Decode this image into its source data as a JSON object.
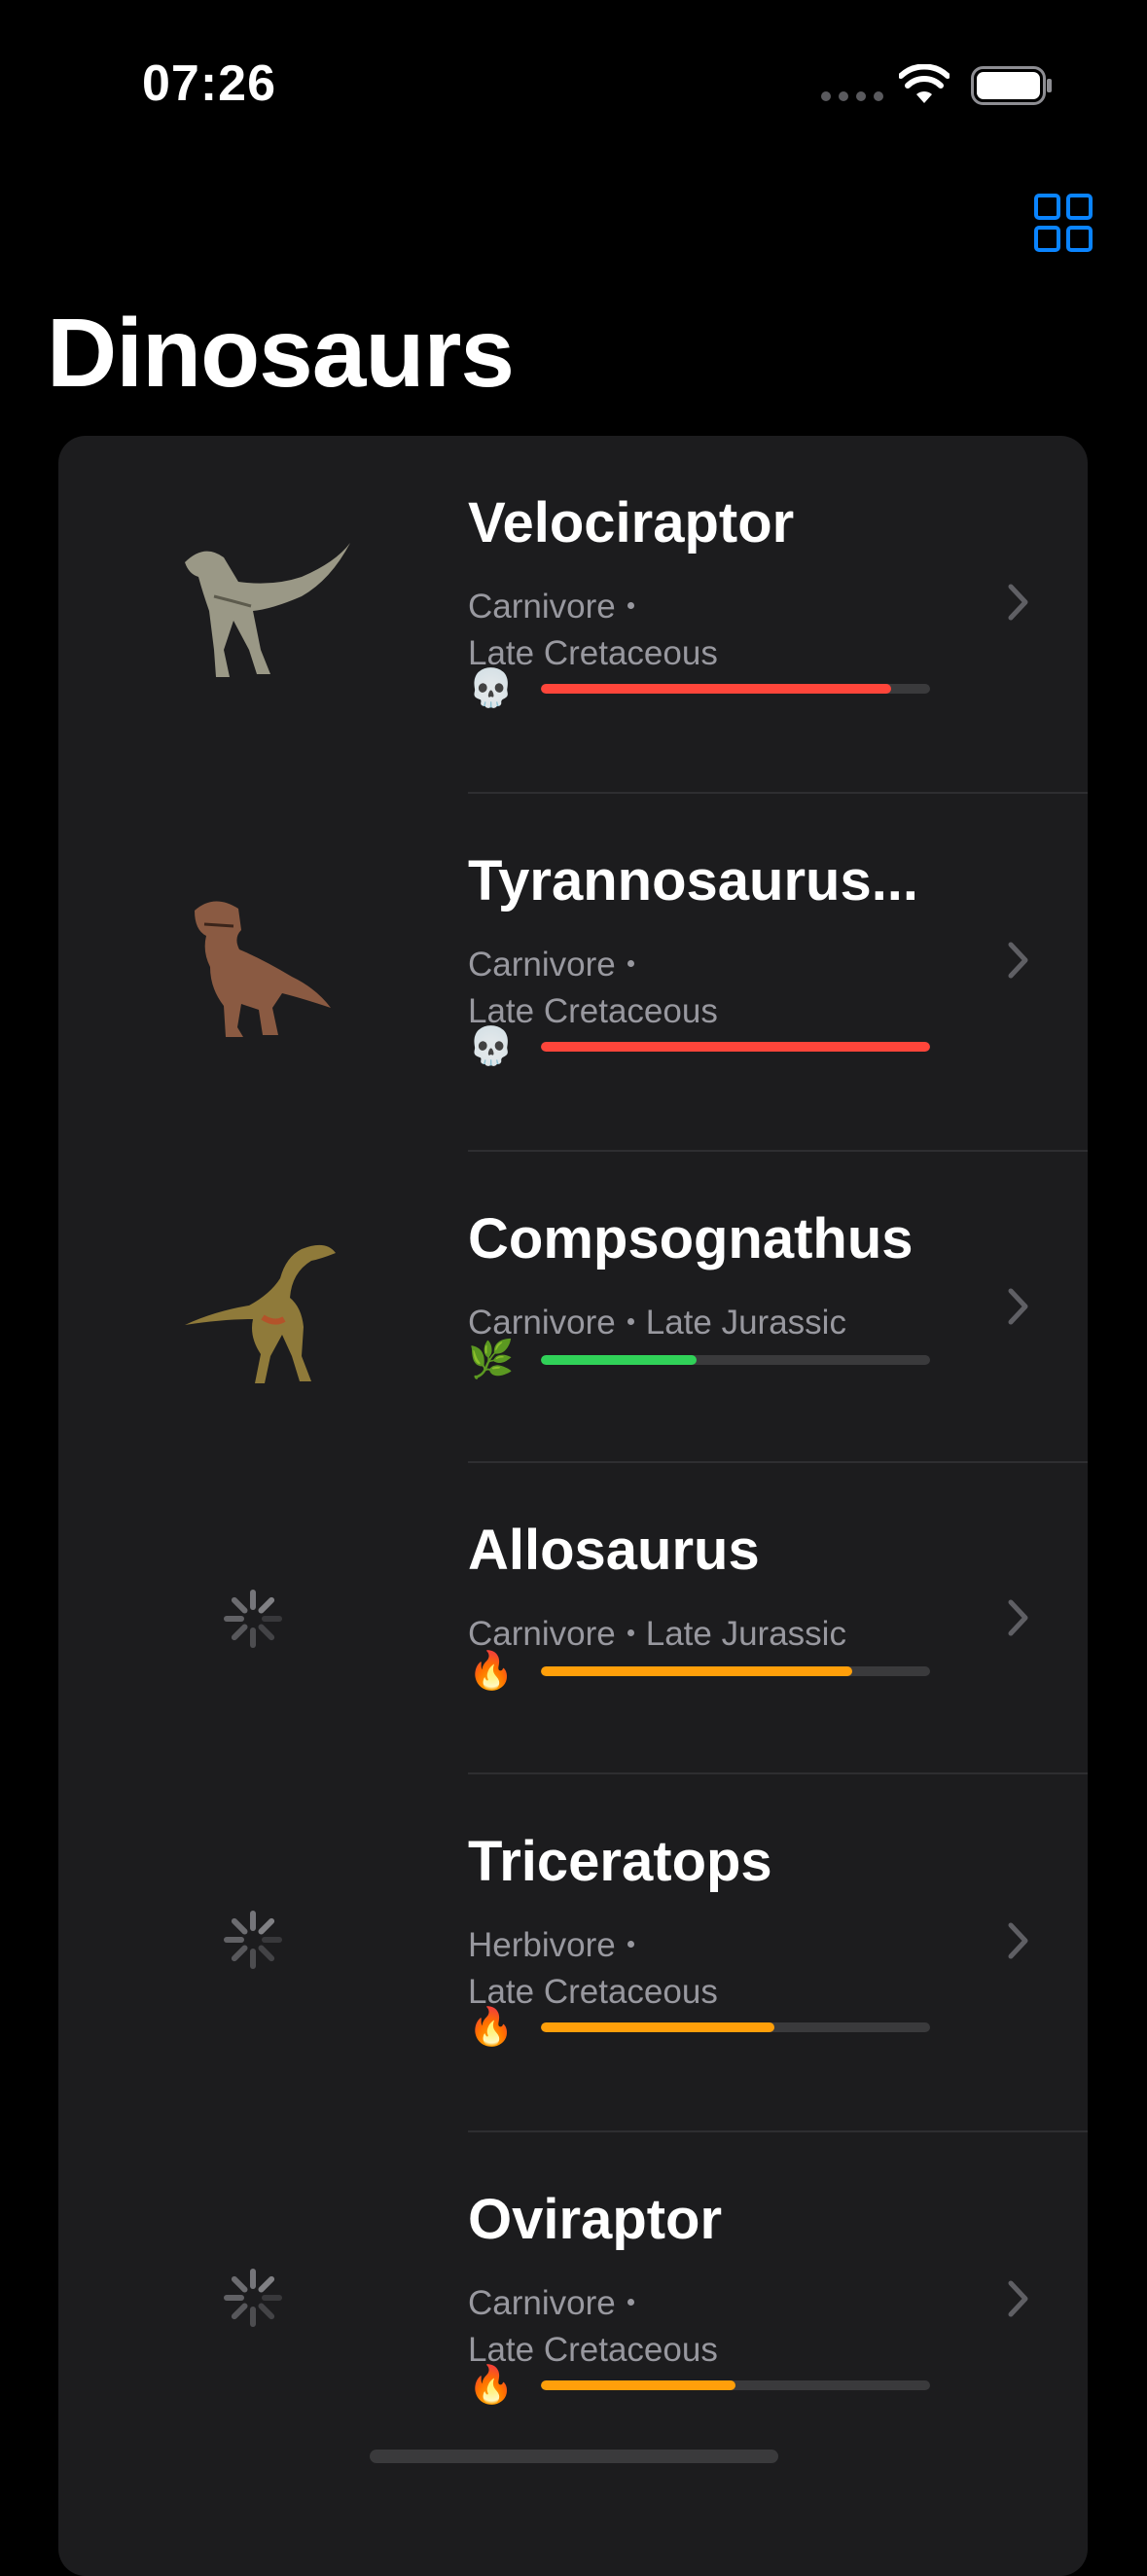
{
  "status_bar": {
    "time": "07:26"
  },
  "toolbar": {
    "layout_toggle_icon": "grid-icon",
    "accent": "#0a84ff"
  },
  "title": "Dinosaurs",
  "rows": [
    {
      "name": "Velociraptor",
      "diet": "Carnivore",
      "period": "Late Cretaceous",
      "badge_icon": "skull-icon",
      "badge_glyph": "💀",
      "danger_level": 0.9,
      "bar_color": "#ff453a",
      "image": "velociraptor-image"
    },
    {
      "name": "Tyrannosaurus...",
      "diet": "Carnivore",
      "period": "Late Cretaceous",
      "badge_icon": "skull-icon",
      "badge_glyph": "💀",
      "danger_level": 1.0,
      "bar_color": "#ff453a",
      "image": "tyrannosaurus-image"
    },
    {
      "name": "Compsognathus",
      "diet": "Carnivore",
      "period": "Late Jurassic",
      "badge_icon": "leaf-icon",
      "badge_glyph": "🌿",
      "danger_level": 0.4,
      "bar_color": "#30d158",
      "image": "compsognathus-image"
    },
    {
      "name": "Allosaurus",
      "diet": "Carnivore",
      "period": "Late Jurassic",
      "badge_icon": "fire-icon",
      "badge_glyph": "🔥",
      "danger_level": 0.8,
      "bar_color": "#ff9f0a",
      "image": "loading-spinner"
    },
    {
      "name": "Triceratops",
      "diet": "Herbivore",
      "period": "Late Cretaceous",
      "badge_icon": "fire-icon",
      "badge_glyph": "🔥",
      "danger_level": 0.6,
      "bar_color": "#ff9f0a",
      "image": "loading-spinner"
    },
    {
      "name": "Oviraptor",
      "diet": "Carnivore",
      "period": "Late Cretaceous",
      "badge_icon": "fire-icon",
      "badge_glyph": "🔥",
      "danger_level": 0.5,
      "bar_color": "#ff9f0a",
      "image": "loading-spinner"
    }
  ]
}
